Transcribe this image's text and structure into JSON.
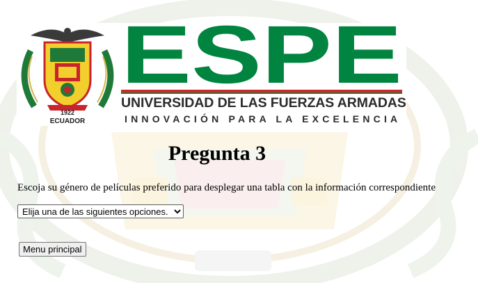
{
  "header": {
    "seal_year": "1922",
    "seal_country": "ECUADOR",
    "brand_name": "ESPE",
    "brand_subtitle": "UNIVERSIDAD DE LAS FUERZAS ARMADAS",
    "brand_slogan": "INNOVACIÓN PARA LA EXCELENCIA",
    "brand_green": "#00843f",
    "brand_red": "#cc2a2a"
  },
  "main": {
    "title": "Pregunta 3",
    "instruction": "Escoja su género de películas preferido para desplegar una tabla con la información correspondiente",
    "genre_select": {
      "selected": "Elija una de las siguientes opciones."
    },
    "menu_button_label": "Menu principal"
  },
  "background": {
    "watermark_icon": "espe-seal-watermark"
  }
}
